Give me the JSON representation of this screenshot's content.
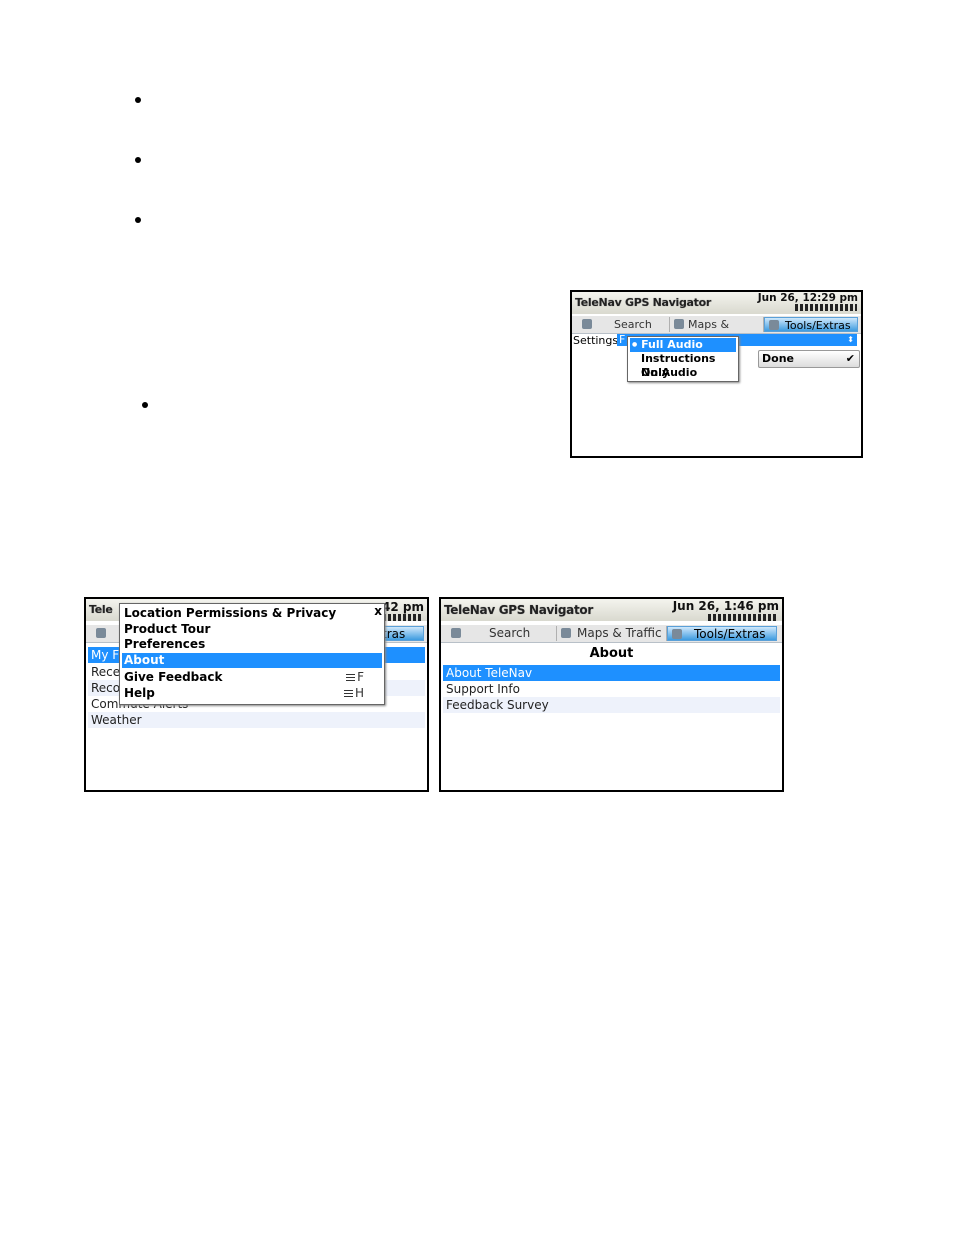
{
  "doc": {
    "bullet_count": 4
  },
  "screenshot1": {
    "app_title": "TeleNav GPS Navigator",
    "time": "Jun 26, 12:29 pm",
    "tabs": [
      "Search",
      "Maps & Traffic",
      "Tools/Extras"
    ],
    "settings_label": "Settings:",
    "settings_value_partial": "F",
    "dropdown_options": [
      "Full Audio",
      "Instructions Only",
      "No Audio"
    ],
    "selected_option": "Full Audio",
    "done_label": "Done"
  },
  "screenshot2": {
    "app_title_partial": "Tele",
    "time_partial": ":42 pm",
    "tab_partial": "tras",
    "list_partial": [
      "My F",
      "Rece",
      "Reco",
      "Commute Alerts",
      "Weather"
    ],
    "menu_items": [
      {
        "label": "Location Permissions & Privacy",
        "shortcut": ""
      },
      {
        "label": "Product Tour",
        "shortcut": ""
      },
      {
        "label": "Preferences",
        "shortcut": ""
      },
      {
        "label": "About",
        "shortcut": ""
      },
      {
        "label": "Give Feedback",
        "shortcut": "F"
      },
      {
        "label": "Help",
        "shortcut": "H"
      }
    ],
    "selected_menu": "About",
    "close_glyph": "x"
  },
  "screenshot3": {
    "app_title": "TeleNav GPS Navigator",
    "time": "Jun 26, 1:46 pm",
    "tabs": [
      "Search",
      "Maps & Traffic",
      "Tools/Extras"
    ],
    "heading": "About",
    "items": [
      "About TeleNav",
      "Support Info",
      "Feedback Survey"
    ],
    "selected_item": "About TeleNav"
  },
  "colors": {
    "selection": "#1e90ff",
    "active_tab": "#3d9be0",
    "list_alt": "#eef2fb"
  }
}
